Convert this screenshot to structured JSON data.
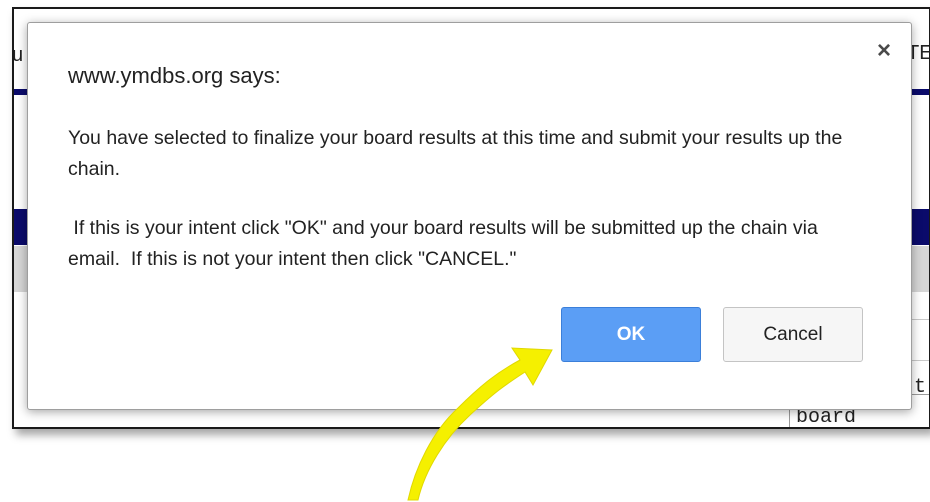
{
  "background_page": {
    "fragments": {
      "left_edge": "u",
      "right_top": "TE",
      "right_mid": "t",
      "right_bottom": "board"
    }
  },
  "dialog": {
    "origin_text": "www.ymdbs.org says:",
    "message_line_1": "You have selected to finalize your board results at this time and submit your results up the chain.",
    "message_line_2": " If this is your intent click \"OK\" and your board results will be submitted up the chain via email.  If this is not your intent then click \"CANCEL.\"",
    "close_glyph": "×",
    "ok_label": "OK",
    "cancel_label": "Cancel"
  },
  "colors": {
    "ok_button": "#5b9ef5",
    "annotation_arrow": "#f5f000",
    "navy_bar": "#0b0b6b"
  },
  "icons": {
    "close": "close-icon",
    "annotation": "yellow-arrow-pointer"
  }
}
